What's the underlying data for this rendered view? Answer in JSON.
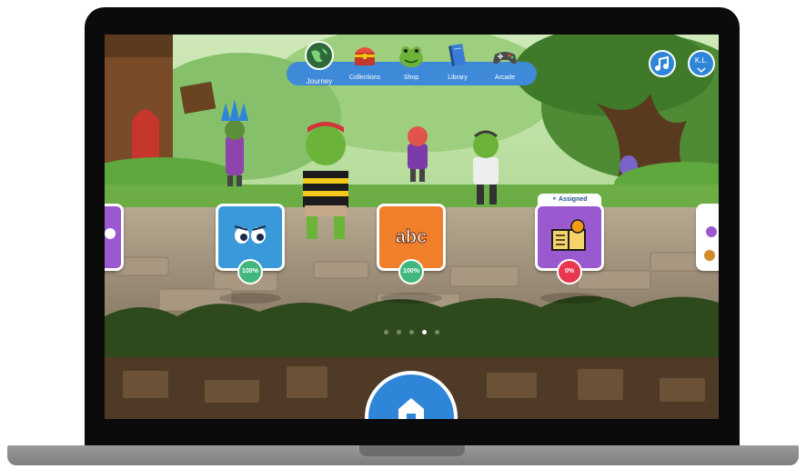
{
  "nav": {
    "items": [
      {
        "label": "Journey",
        "icon": "globe-icon",
        "active": true
      },
      {
        "label": "Collections",
        "icon": "treasure-chest-icon",
        "active": false
      },
      {
        "label": "Shop",
        "icon": "frog-shop-icon",
        "active": false
      },
      {
        "label": "Library",
        "icon": "book-icon",
        "active": false
      },
      {
        "label": "Arcade",
        "icon": "gamepad-icon",
        "active": false
      }
    ]
  },
  "header": {
    "music_icon": "music-note-icon",
    "user_initials": "K.L.",
    "user_chevron": "chevron-down-icon"
  },
  "cards": [
    {
      "icon": "partial-card",
      "progress": null,
      "color": "#9b59d0"
    },
    {
      "icon": "eyes-icon",
      "progress": "100%",
      "color": "#3a9ad9"
    },
    {
      "icon": "abc-icon",
      "progress": "100%",
      "color": "#f07f2b"
    },
    {
      "icon": "lightbulb-book-icon",
      "progress": "0%",
      "color": "#9b59d0",
      "tag": "Assigned"
    },
    {
      "icon": "partial-card",
      "progress": null,
      "color": "#9b59d0"
    }
  ],
  "pager": {
    "count": 5,
    "active_index": 3
  },
  "home": {
    "icon": "home-icon"
  },
  "colors": {
    "nav_blue": "#3f8ad8",
    "complete_green": "#41b77d",
    "incomplete_red": "#e8374f"
  }
}
